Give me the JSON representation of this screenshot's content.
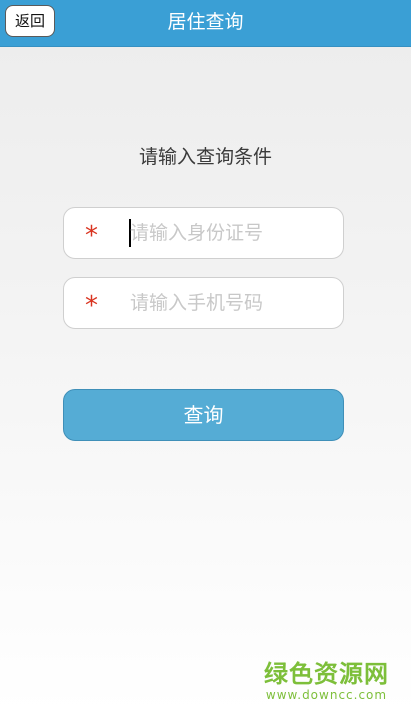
{
  "header": {
    "back_label": "返回",
    "title": "居住查询"
  },
  "form": {
    "prompt": "请输入查询条件",
    "required_mark": "*",
    "id_field": {
      "placeholder": "请输入身份证号",
      "value": ""
    },
    "phone_field": {
      "placeholder": "请输入手机号码",
      "value": ""
    },
    "submit_label": "查询"
  },
  "watermark": {
    "title": "绿色资源网",
    "url": "www.downcc.com"
  },
  "colors": {
    "header": "#3a9fd5",
    "button": "#55acd5",
    "required": "#d9331f",
    "watermark": "#7dbf3a"
  }
}
